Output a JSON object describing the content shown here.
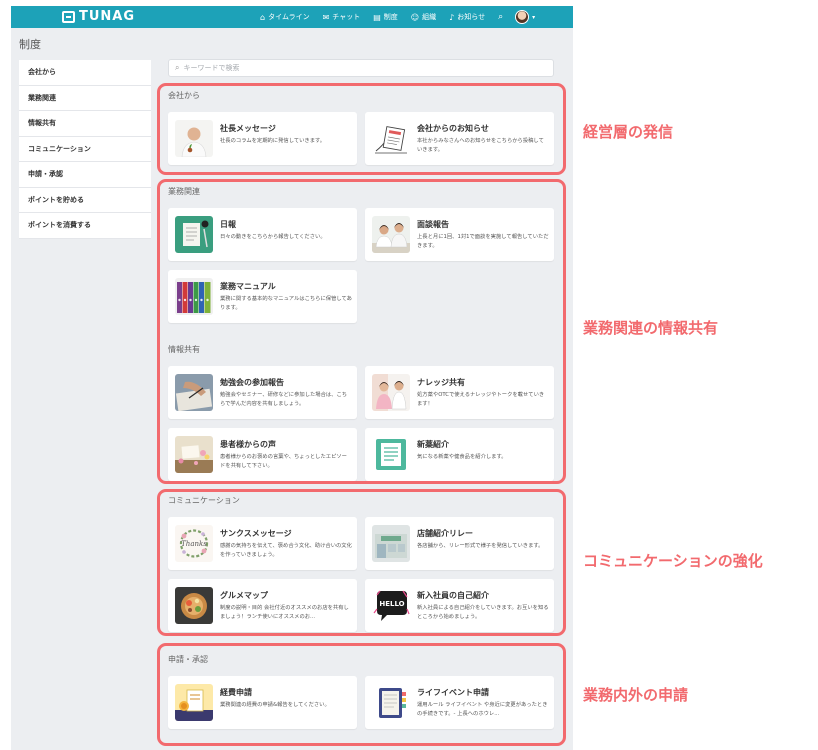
{
  "nav": {
    "logo_text": "TUNAG",
    "items": [
      {
        "icon": "⌂",
        "label": "タイムライン"
      },
      {
        "icon": "✉",
        "label": "チャット"
      },
      {
        "icon": "▤",
        "label": "制度"
      },
      {
        "icon": "☺",
        "label": "組織"
      },
      {
        "icon": "♪",
        "label": "お知らせ"
      }
    ],
    "search_icon": "⌕",
    "caret": "▾"
  },
  "page": {
    "title": "制度"
  },
  "sidebar": {
    "items": [
      {
        "label": "会社から"
      },
      {
        "label": "業務関連"
      },
      {
        "label": "情報共有"
      },
      {
        "label": "コミュニケーション"
      },
      {
        "label": "申請・承認"
      },
      {
        "label": "ポイントを貯める"
      },
      {
        "label": "ポイントを消費する"
      }
    ]
  },
  "search": {
    "placeholder": "キーワードで検索",
    "icon": "⌕"
  },
  "sections": [
    {
      "label": "会社から",
      "cards": [
        {
          "title": "社長メッセージ",
          "desc": "社長のコラムを定期的に発信していきます。"
        },
        {
          "title": "会社からのお知らせ",
          "desc": "本社からみなさんへのお知らせをこちらから投稿していきます。"
        }
      ]
    },
    {
      "label": "業務関連",
      "cards": [
        {
          "title": "日報",
          "desc": "日々の動きをこちらから報告してください。"
        },
        {
          "title": "面談報告",
          "desc": "上長と月に1回、1対1で面談を実施して報告していただきます。"
        },
        {
          "title": "業務マニュアル",
          "desc": "業務に関する基本的なマニュアルはこちらに保管してあります。"
        }
      ]
    },
    {
      "label": "情報共有",
      "cards": [
        {
          "title": "勉強会の参加報告",
          "desc": "勉強会やセミナー、研修などに参加した場合は、こちらで学んだ内容を共有しましょう。"
        },
        {
          "title": "ナレッジ共有",
          "desc": "処方薬やOTCで使えるナレッジやトークを載せていきます！"
        },
        {
          "title": "患者様からの声",
          "desc": "患者様からのお褒めの言葉や、ちょっとしたエピソードを共有して下さい。"
        },
        {
          "title": "新薬紹介",
          "desc": "気になる新薬や健食品を紹介します。"
        }
      ]
    },
    {
      "label": "コミュニケーション",
      "cards": [
        {
          "title": "サンクスメッセージ",
          "desc": "感謝の気持ちを伝えて、褒め合う文化、助け合いの文化を作っていきましょう。"
        },
        {
          "title": "店舗紹介リレー",
          "desc": "各店舗から、リレー形式で様子を発信していきます。"
        },
        {
          "title": "グルメマップ",
          "desc": "制度の説明・目的 会社付近のオススメのお店を共有しましょう！ランチ使いにオススメのお..."
        },
        {
          "title": "新入社員の自己紹介",
          "desc": "新入社員による自己紹介をしていきます。お互いを知るところから始めましょう。"
        }
      ]
    },
    {
      "label": "申請・承認",
      "cards": [
        {
          "title": "経費申請",
          "desc": "業務関連の経費の申請&報告をしてください。"
        },
        {
          "title": "ライフイベント申請",
          "desc": "運用ルール ライフイベント や身近に変更があったときの手続きです。- 上長へのホウレ..."
        }
      ]
    }
  ],
  "thumbs": {
    "thanks_text": "Thanks",
    "hello_text": "HELLO"
  },
  "annotations": [
    {
      "label": "経営層の発信"
    },
    {
      "label": "業務関連の情報共有"
    },
    {
      "label": "コミュニケーションの強化"
    },
    {
      "label": "業務内外の申請"
    }
  ],
  "colors": {
    "nav": "#1da2b8",
    "highlight": "#f26a6e",
    "background": "#eceef1"
  }
}
